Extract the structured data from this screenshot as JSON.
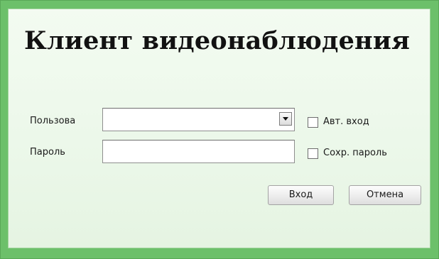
{
  "dialog": {
    "title": "Клиент видеонаблюдения"
  },
  "form": {
    "user_label": "Пользова",
    "user_value": "",
    "password_label": "Пароль",
    "password_value": "",
    "auto_login_label": "Авт. вход",
    "auto_login_checked": false,
    "save_password_label": "Сохр. пароль",
    "save_password_checked": false
  },
  "buttons": {
    "login_label": "Вход",
    "cancel_label": "Отмена"
  },
  "colors": {
    "frame": "#6cc06a",
    "dialog_background": "#f0faee"
  },
  "icons": {
    "dropdown": "chevron-down-icon"
  }
}
